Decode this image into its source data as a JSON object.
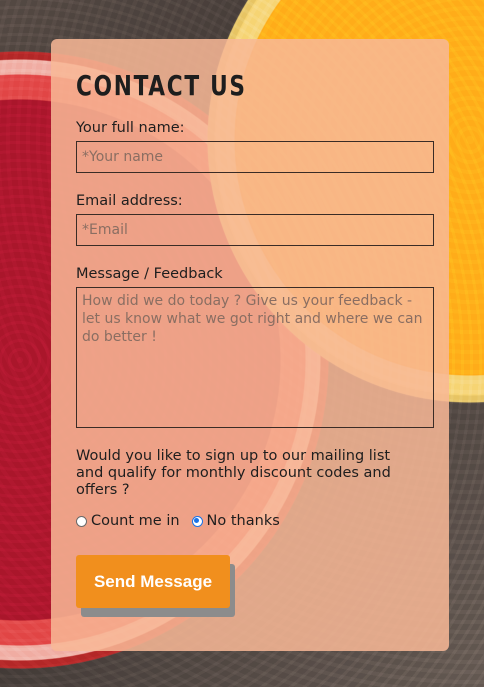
{
  "form": {
    "title": "CONTACT US",
    "name_label": "Your full name:",
    "name_placeholder": "*Your name",
    "email_label": "Email address:",
    "email_placeholder": "*Email",
    "message_label": "Message / Feedback",
    "message_placeholder": "How did we do today ? Give us your feedback - let us know what we got right and where we can do better !",
    "mailing_question": "Would you like to sign up to our mailing list and qualify for monthly discount codes and offers ?",
    "option_yes": "Count me in",
    "option_no": "No thanks",
    "selected_option": "No thanks",
    "submit_label": "Send Message"
  },
  "colors": {
    "card": "#f8b896",
    "button": "#f18f1d",
    "radio_accent": "#1a73e8"
  }
}
